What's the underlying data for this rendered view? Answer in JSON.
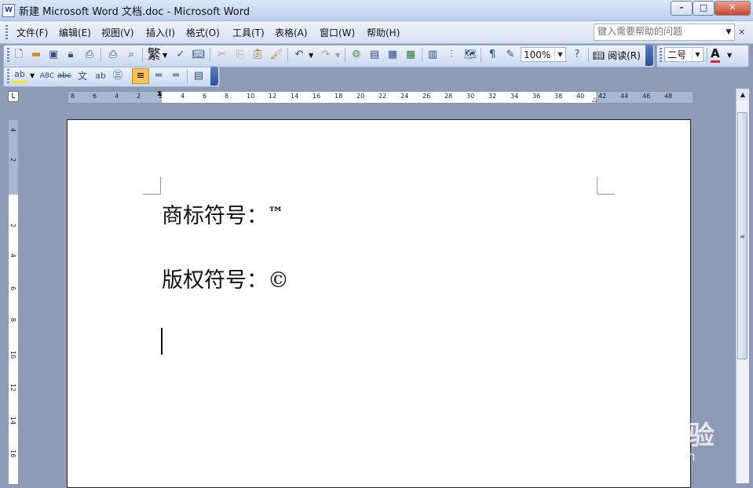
{
  "window": {
    "title": "新建 Microsoft Word 文档.doc - Microsoft Word",
    "app_icon": "W",
    "minimize": "–",
    "maximize": "□",
    "close": "✕"
  },
  "menu": [
    {
      "label": "文件(F)"
    },
    {
      "label": "编辑(E)"
    },
    {
      "label": "视图(V)"
    },
    {
      "label": "插入(I)"
    },
    {
      "label": "格式(O)"
    },
    {
      "label": "工具(T)"
    },
    {
      "label": "表格(A)"
    },
    {
      "label": "窗口(W)"
    },
    {
      "label": "帮助(H)"
    }
  ],
  "help_search": {
    "placeholder": "键入需要帮助的问题"
  },
  "standard_toolbar": {
    "traditional_chinese": "繁",
    "zoom": "100%",
    "read_mode": "阅读(R)",
    "font_size": "二号",
    "font_color_letter": "A"
  },
  "ruler": {
    "horizontal": [
      "8",
      "6",
      "4",
      "2",
      "2",
      "4",
      "6",
      "8",
      "10",
      "12",
      "14",
      "16",
      "18",
      "20",
      "22",
      "24",
      "26",
      "28",
      "30",
      "32",
      "34",
      "36",
      "38",
      "40",
      "42",
      "44",
      "46",
      "48"
    ],
    "vertical": [
      "4",
      "2",
      "2",
      "4",
      "6",
      "8",
      "10",
      "12",
      "14",
      "16"
    ],
    "tab_selector": "L"
  },
  "document": {
    "lines": [
      {
        "label": "商标符号：",
        "symbol": "™"
      },
      {
        "label": "版权符号：",
        "symbol": "©"
      }
    ]
  },
  "watermark": {
    "brand": "Baidu经验",
    "url": "jingyan.baidu.com"
  }
}
